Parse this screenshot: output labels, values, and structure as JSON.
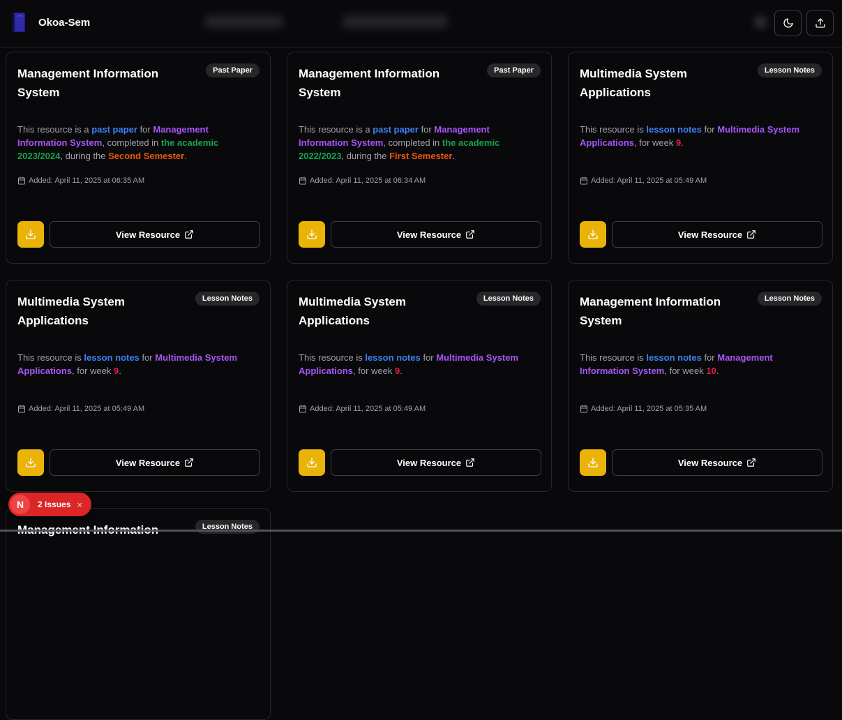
{
  "header": {
    "brand": "Okoa-Sem",
    "theme_toggle_icon": "moon-icon",
    "upload_icon": "upload-icon"
  },
  "colors": {
    "accent_download": "#eab308",
    "resource_type": "#3b82f6",
    "course": "#a855f7",
    "academic_year": "#16a34a",
    "semester": "#ea580c",
    "week": "#e11d48"
  },
  "cards": [
    {
      "title": "Management Information System",
      "badge": "Past Paper",
      "desc": [
        {
          "t": "This resource is a ",
          "c": ""
        },
        {
          "t": "past paper",
          "c": "c-blue"
        },
        {
          "t": " for ",
          "c": ""
        },
        {
          "t": "Management Information System",
          "c": "c-purple"
        },
        {
          "t": ", completed in ",
          "c": ""
        },
        {
          "t": "the academic 2023/2024",
          "c": "c-green"
        },
        {
          "t": ", during the ",
          "c": ""
        },
        {
          "t": "Second Semester",
          "c": "c-orange"
        },
        {
          "t": ".",
          "c": ""
        }
      ],
      "added": "Added: April 11, 2025 at 06:35 AM",
      "view_label": "View Resource"
    },
    {
      "title": "Management Information System",
      "badge": "Past Paper",
      "desc": [
        {
          "t": "This resource is a ",
          "c": ""
        },
        {
          "t": "past paper",
          "c": "c-blue"
        },
        {
          "t": " for ",
          "c": ""
        },
        {
          "t": "Management Information System",
          "c": "c-purple"
        },
        {
          "t": ", completed in ",
          "c": ""
        },
        {
          "t": "the academic 2022/2023",
          "c": "c-green"
        },
        {
          "t": ", during the ",
          "c": ""
        },
        {
          "t": "First Semester",
          "c": "c-orange"
        },
        {
          "t": ".",
          "c": ""
        }
      ],
      "added": "Added: April 11, 2025 at 06:34 AM",
      "view_label": "View Resource"
    },
    {
      "title": "Multimedia System Applications",
      "badge": "Lesson Notes",
      "desc": [
        {
          "t": "This resource is ",
          "c": ""
        },
        {
          "t": "lesson notes",
          "c": "c-blue"
        },
        {
          "t": " for ",
          "c": ""
        },
        {
          "t": "Multimedia System Applications",
          "c": "c-purple"
        },
        {
          "t": ", for week ",
          "c": ""
        },
        {
          "t": "9",
          "c": "c-pink"
        },
        {
          "t": ".",
          "c": ""
        }
      ],
      "added": "Added: April 11, 2025 at 05:49 AM",
      "view_label": "View Resource"
    },
    {
      "title": "Multimedia System Applications",
      "badge": "Lesson Notes",
      "desc": [
        {
          "t": "This resource is ",
          "c": ""
        },
        {
          "t": "lesson notes",
          "c": "c-blue"
        },
        {
          "t": " for ",
          "c": ""
        },
        {
          "t": "Multimedia System Applications",
          "c": "c-purple"
        },
        {
          "t": ", for week ",
          "c": ""
        },
        {
          "t": "9",
          "c": "c-pink"
        },
        {
          "t": ".",
          "c": ""
        }
      ],
      "added": "Added: April 11, 2025 at 05:49 AM",
      "view_label": "View Resource"
    },
    {
      "title": "Multimedia System Applications",
      "badge": "Lesson Notes",
      "desc": [
        {
          "t": "This resource is ",
          "c": ""
        },
        {
          "t": "lesson notes",
          "c": "c-blue"
        },
        {
          "t": " for ",
          "c": ""
        },
        {
          "t": "Multimedia System Applications",
          "c": "c-purple"
        },
        {
          "t": ", for week ",
          "c": ""
        },
        {
          "t": "9",
          "c": "c-pink"
        },
        {
          "t": ".",
          "c": ""
        }
      ],
      "added": "Added: April 11, 2025 at 05:49 AM",
      "view_label": "View Resource"
    },
    {
      "title": "Management Information System",
      "badge": "Lesson Notes",
      "desc": [
        {
          "t": "This resource is ",
          "c": ""
        },
        {
          "t": "lesson notes",
          "c": "c-blue"
        },
        {
          "t": " for ",
          "c": ""
        },
        {
          "t": "Management Information System",
          "c": "c-purple"
        },
        {
          "t": ", for week ",
          "c": ""
        },
        {
          "t": "10",
          "c": "c-pink"
        },
        {
          "t": ".",
          "c": ""
        }
      ],
      "added": "Added: April 11, 2025 at 05:35 AM",
      "view_label": "View Resource"
    },
    {
      "title": "Management Information",
      "badge": "Lesson Notes",
      "desc": [],
      "added": "",
      "view_label": ""
    }
  ],
  "issues_badge": {
    "letter": "N",
    "label": "2 Issues",
    "close": "×"
  }
}
